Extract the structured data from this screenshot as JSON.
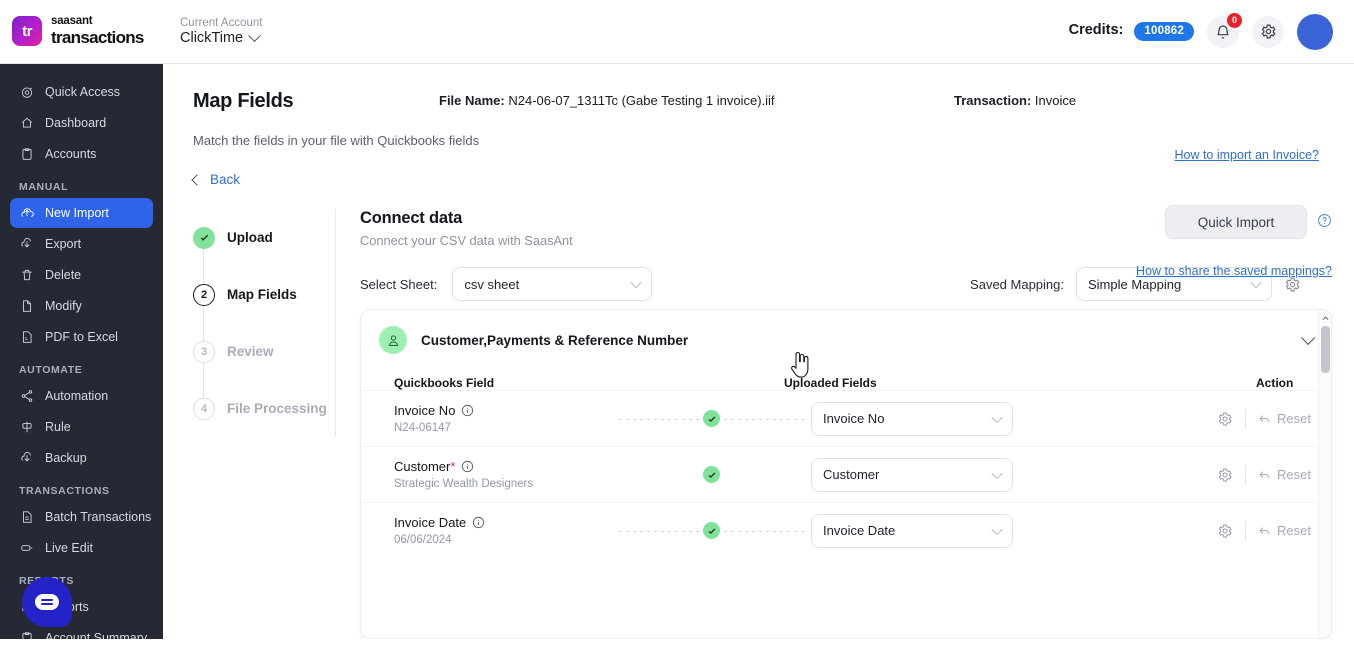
{
  "brand": {
    "top": "saasant",
    "bottom": "transactions",
    "logo_text": "tr"
  },
  "account": {
    "label": "Current Account",
    "name": "ClickTime"
  },
  "topbar": {
    "credits_label": "Credits:",
    "credits_value": "100862",
    "notification_badge": "0",
    "accent_blue": "#1f76e8"
  },
  "sidebar": {
    "items": [
      {
        "label": "Quick Access",
        "icon": "target-icon",
        "active": false
      },
      {
        "label": "Dashboard",
        "icon": "home-icon",
        "active": false
      },
      {
        "label": "Accounts",
        "icon": "clipboard-icon",
        "active": false
      }
    ],
    "groups": [
      {
        "title": "MANUAL",
        "items": [
          {
            "label": "New Import",
            "icon": "upload-cloud-icon",
            "active": true
          },
          {
            "label": "Export",
            "icon": "download-icon",
            "active": false
          },
          {
            "label": "Delete",
            "icon": "trash-icon",
            "active": false
          },
          {
            "label": "Modify",
            "icon": "file-edit-icon",
            "active": false
          },
          {
            "label": "PDF to Excel",
            "icon": "file-pdf-icon",
            "active": false
          }
        ]
      },
      {
        "title": "AUTOMATE",
        "items": [
          {
            "label": "Automation",
            "icon": "share-nodes-icon",
            "active": false
          },
          {
            "label": "Rule",
            "icon": "rule-icon",
            "active": false
          },
          {
            "label": "Backup",
            "icon": "download-icon",
            "active": false
          }
        ]
      },
      {
        "title": "TRANSACTIONS",
        "items": [
          {
            "label": "Batch Transactions",
            "icon": "document-icon",
            "active": false
          },
          {
            "label": "Live Edit",
            "icon": "edit-tag-icon",
            "active": false
          }
        ]
      },
      {
        "title": "REPORTS",
        "items": [
          {
            "label": "Reports",
            "icon": "chart-icon",
            "active": false
          },
          {
            "label": "Account Summary",
            "icon": "clipboard-icon",
            "active": false
          }
        ]
      }
    ]
  },
  "page": {
    "title": "Map Fields",
    "file_label": "File Name:",
    "file_value": "N24-06-07_1311Tc (Gabe Testing 1 invoice).iif",
    "transaction_label": "Transaction:",
    "transaction_value": "Invoice",
    "subtitle": "Match the fields in your file with Quickbooks fields",
    "how_to_import_link": "How to import an Invoice?",
    "back_label": "Back"
  },
  "stepper": [
    {
      "num": "1",
      "label": "Upload",
      "state": "done"
    },
    {
      "num": "2",
      "label": "Map Fields",
      "state": "current"
    },
    {
      "num": "3",
      "label": "Review",
      "state": "todo"
    },
    {
      "num": "4",
      "label": "File Processing",
      "state": "todo"
    }
  ],
  "connect": {
    "title": "Connect data",
    "subtitle": "Connect your CSV data with SaasAnt",
    "quick_import_label": "Quick Import",
    "select_sheet_label": "Select Sheet:",
    "select_sheet_value": "csv sheet",
    "saved_mapping_label": "Saved Mapping:",
    "saved_mapping_value": "Simple Mapping",
    "share_link": "How to share the saved mappings?"
  },
  "mapping_card": {
    "section_title": "Customer,Payments & Reference Number",
    "columns": {
      "qb": "Quickbooks Field",
      "uploaded": "Uploaded Fields",
      "action": "Action"
    },
    "reset_label": "Reset",
    "rows": [
      {
        "qb_field": "Invoice No",
        "required": false,
        "sample_value": "N24-06147",
        "mapped": true,
        "uploaded_field": "Invoice No"
      },
      {
        "qb_field": "Customer",
        "required": true,
        "sample_value": "Strategic Wealth Designers",
        "mapped": true,
        "uploaded_field": "Customer"
      },
      {
        "qb_field": "Invoice Date",
        "required": false,
        "sample_value": "06/06/2024",
        "mapped": true,
        "uploaded_field": "Invoice Date"
      }
    ]
  }
}
